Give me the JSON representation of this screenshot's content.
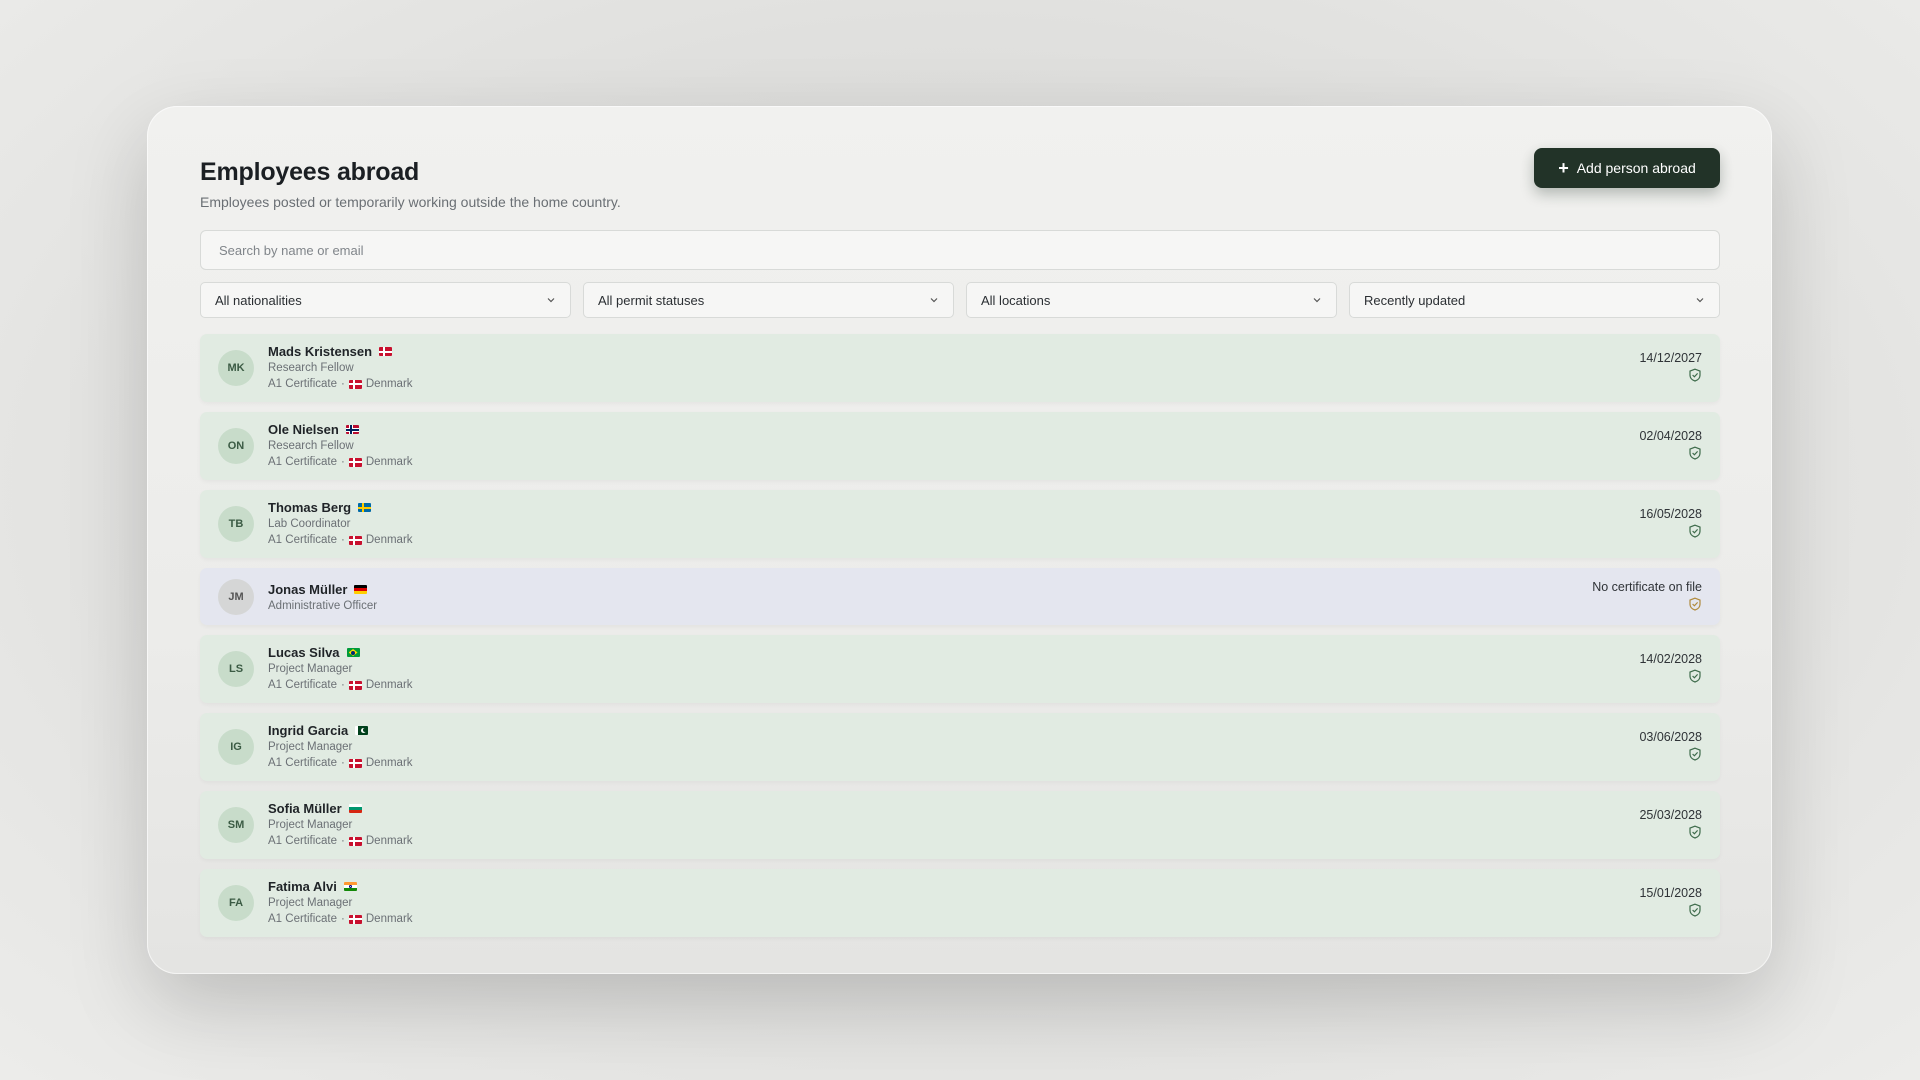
{
  "header": {
    "title": "Employees abroad",
    "subtitle": "Employees posted or temporarily working outside the home country.",
    "add_button_label": "Add person abroad"
  },
  "search": {
    "placeholder": "Search by name or email",
    "value": ""
  },
  "filters": {
    "nationality": "All nationalities",
    "permit_status": "All permit statuses",
    "location": "All locations",
    "sort": "Recently updated"
  },
  "colors": {
    "accent": "#223328",
    "certified_row": "#e1ebe2",
    "missing_row": "#e4e6ef",
    "shield_ok": "#3e6b4b",
    "shield_warning": "#b08a3c"
  },
  "employees": [
    {
      "initials": "MK",
      "name": "Mads Kristensen",
      "nationality_flag": "denmark",
      "role": "Research Fellow",
      "certificate": "A1 Certificate",
      "location": "Denmark",
      "location_flag": "denmark",
      "date": "14/12/2027",
      "status_icon": "shield-check-icon"
    },
    {
      "initials": "ON",
      "name": "Ole Nielsen",
      "nationality_flag": "norway",
      "role": "Research Fellow",
      "certificate": "A1 Certificate",
      "location": "Denmark",
      "location_flag": "denmark",
      "date": "02/04/2028",
      "status_icon": "shield-check-icon"
    },
    {
      "initials": "TB",
      "name": "Thomas Berg",
      "nationality_flag": "sweden",
      "role": "Lab Coordinator",
      "certificate": "A1 Certificate",
      "location": "Denmark",
      "location_flag": "denmark",
      "date": "16/05/2028",
      "status_icon": "shield-check-icon"
    },
    {
      "initials": "JM",
      "name": "Jonas Müller",
      "nationality_flag": "germany",
      "role": "Administrative Officer",
      "certificate": "",
      "location": "",
      "location_flag": "",
      "date": "No certificate on file",
      "status_icon": "shield-warning-icon"
    },
    {
      "initials": "LS",
      "name": "Lucas Silva",
      "nationality_flag": "brazil",
      "role": "Project Manager",
      "certificate": "A1 Certificate",
      "location": "Denmark",
      "location_flag": "denmark",
      "date": "14/02/2028",
      "status_icon": "shield-check-icon"
    },
    {
      "initials": "IG",
      "name": "Ingrid Garcia",
      "nationality_flag": "pakistan",
      "role": "Project Manager",
      "certificate": "A1 Certificate",
      "location": "Denmark",
      "location_flag": "denmark",
      "date": "03/06/2028",
      "status_icon": "shield-check-icon"
    },
    {
      "initials": "SM",
      "name": "Sofia Müller",
      "nationality_flag": "bulgaria",
      "role": "Project Manager",
      "certificate": "A1 Certificate",
      "location": "Denmark",
      "location_flag": "denmark",
      "date": "25/03/2028",
      "status_icon": "shield-check-icon"
    },
    {
      "initials": "FA",
      "name": "Fatima Alvi",
      "nationality_flag": "india",
      "role": "Project Manager",
      "certificate": "A1 Certificate",
      "location": "Denmark",
      "location_flag": "denmark",
      "date": "15/01/2028",
      "status_icon": "shield-check-icon"
    }
  ]
}
